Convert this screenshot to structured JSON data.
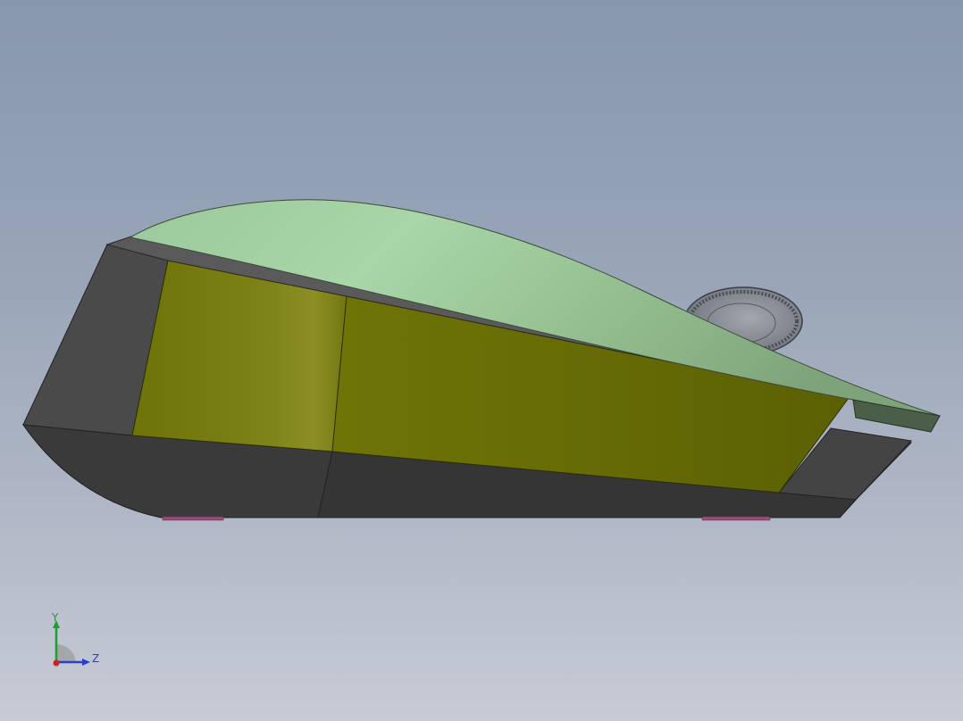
{
  "viewport": {
    "background_top": "#8797ad",
    "background_bottom": "#c7cbd6"
  },
  "model": {
    "name": "computer-mouse",
    "colors": {
      "shell_top": "#9cc99c",
      "side_panel": "#7a8011",
      "base": "#3a3a3a",
      "scroll_wheel": "#8a8e95",
      "feet": "#9b4a7a"
    }
  },
  "triad": {
    "y_label": "Y",
    "z_label": "Z",
    "y_color": "#1e9e2a",
    "z_color": "#2a3fd0",
    "x_color": "#d02020"
  }
}
